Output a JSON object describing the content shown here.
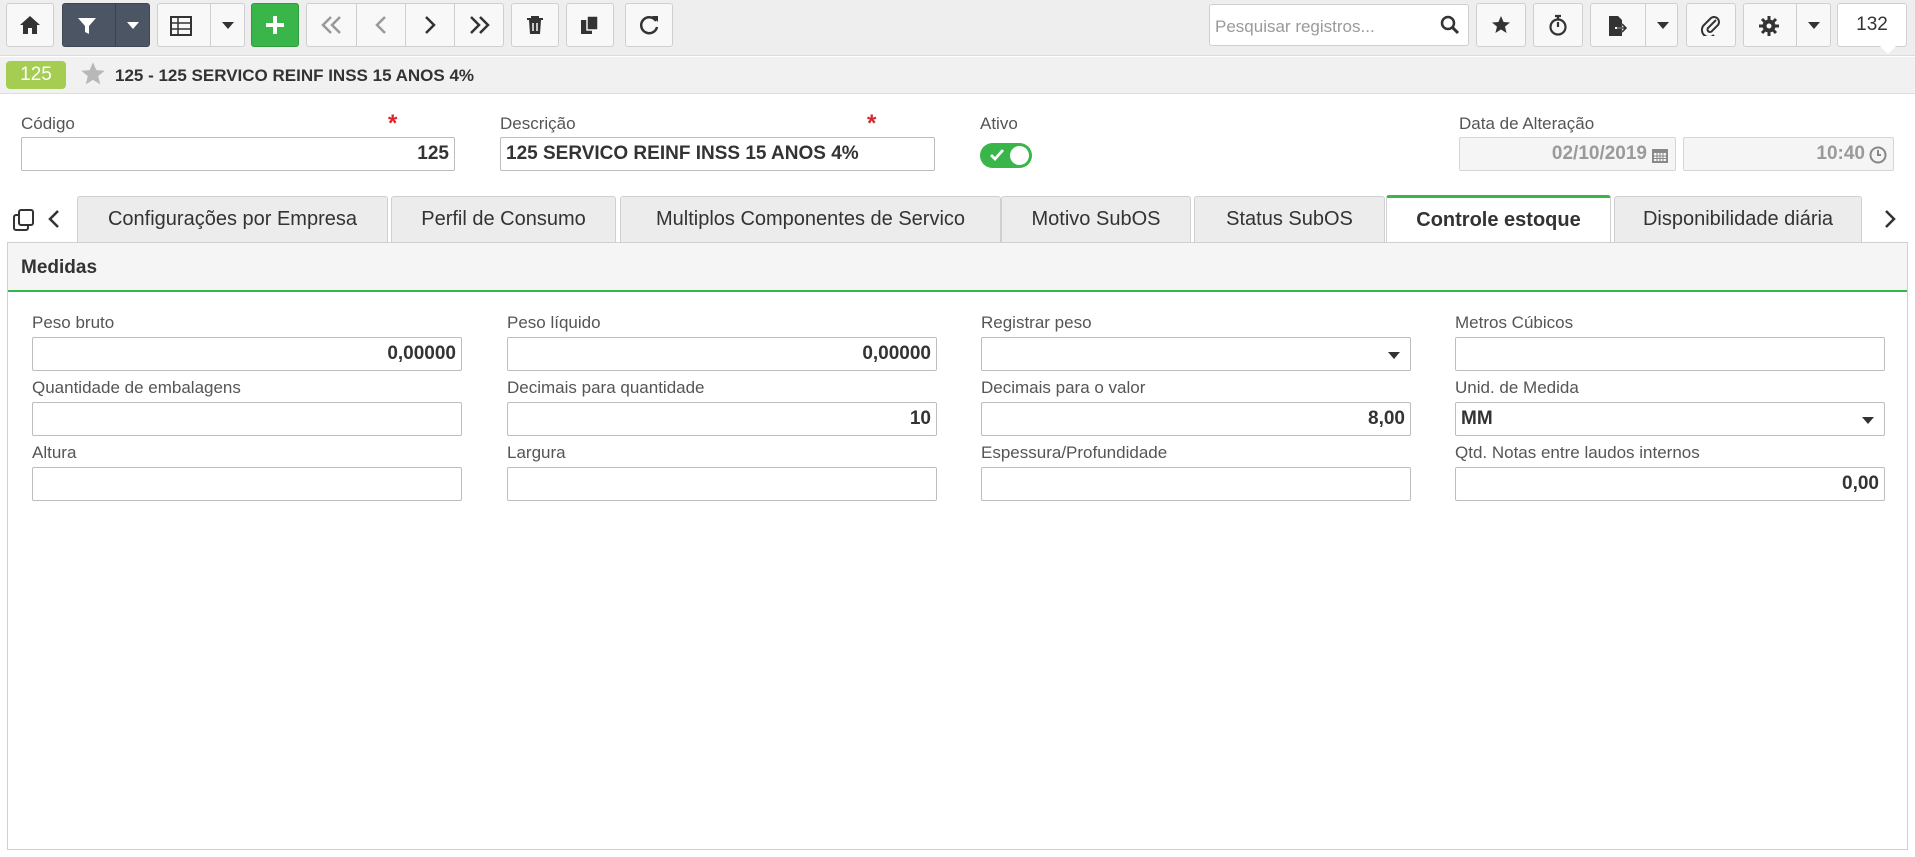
{
  "toolbar": {
    "search_placeholder": "Pesquisar registros...",
    "record_count": "132"
  },
  "record": {
    "badge": "125",
    "title": "125 - 125 SERVICO REINF INSS 15 ANOS 4%"
  },
  "form": {
    "codigo_label": "Código",
    "codigo_value": "125",
    "descricao_label": "Descrição",
    "descricao_value": "125 SERVICO REINF INSS 15 ANOS 4%",
    "ativo_label": "Ativo",
    "ativo_value": true,
    "data_alteracao_label": "Data de Alteração",
    "data_value": "02/10/2019",
    "hora_value": "10:40",
    "required_mark": "*"
  },
  "tabs": [
    {
      "label": "Configurações por Empresa"
    },
    {
      "label": "Perfil de Consumo"
    },
    {
      "label": "Multiplos Componentes de Servico"
    },
    {
      "label": "Motivo SubOS"
    },
    {
      "label": "Status SubOS"
    },
    {
      "label": "Controle estoque",
      "active": true
    },
    {
      "label": "Disponibilidade diária"
    }
  ],
  "panel": {
    "title": "Medidas",
    "fields": {
      "peso_bruto": {
        "label": "Peso bruto",
        "value": "0,00000"
      },
      "peso_liquido": {
        "label": "Peso líquido",
        "value": "0,00000"
      },
      "registrar_peso": {
        "label": "Registrar peso",
        "value": ""
      },
      "metros_cubicos": {
        "label": "Metros Cúbicos",
        "value": ""
      },
      "qtd_embalagens": {
        "label": "Quantidade de embalagens",
        "value": ""
      },
      "decimais_quantidade": {
        "label": "Decimais para quantidade",
        "value": "10"
      },
      "decimais_valor": {
        "label": "Decimais para o valor",
        "value": "8,00"
      },
      "unid_medida": {
        "label": "Unid. de Medida",
        "value": "MM"
      },
      "altura": {
        "label": "Altura",
        "value": ""
      },
      "largura": {
        "label": "Largura",
        "value": ""
      },
      "espessura": {
        "label": "Espessura/Profundidade",
        "value": ""
      },
      "qtd_notas": {
        "label": "Qtd. Notas entre laudos internos",
        "value": "0,00"
      }
    }
  },
  "colors": {
    "accent_green": "#3ab54a",
    "badge_green": "#a4cd52",
    "filter_dark": "#4b5563",
    "required_red": "#d9262c"
  },
  "icons": [
    "home-icon",
    "filter-icon",
    "table-icon",
    "plus-icon",
    "first-icon",
    "prev-icon",
    "next-icon",
    "last-icon",
    "trash-icon",
    "copy-icon",
    "refresh-icon",
    "search-icon",
    "star-icon",
    "timer-icon",
    "export-icon",
    "paperclip-icon",
    "gear-icon",
    "calendar-icon",
    "clock-icon"
  ]
}
